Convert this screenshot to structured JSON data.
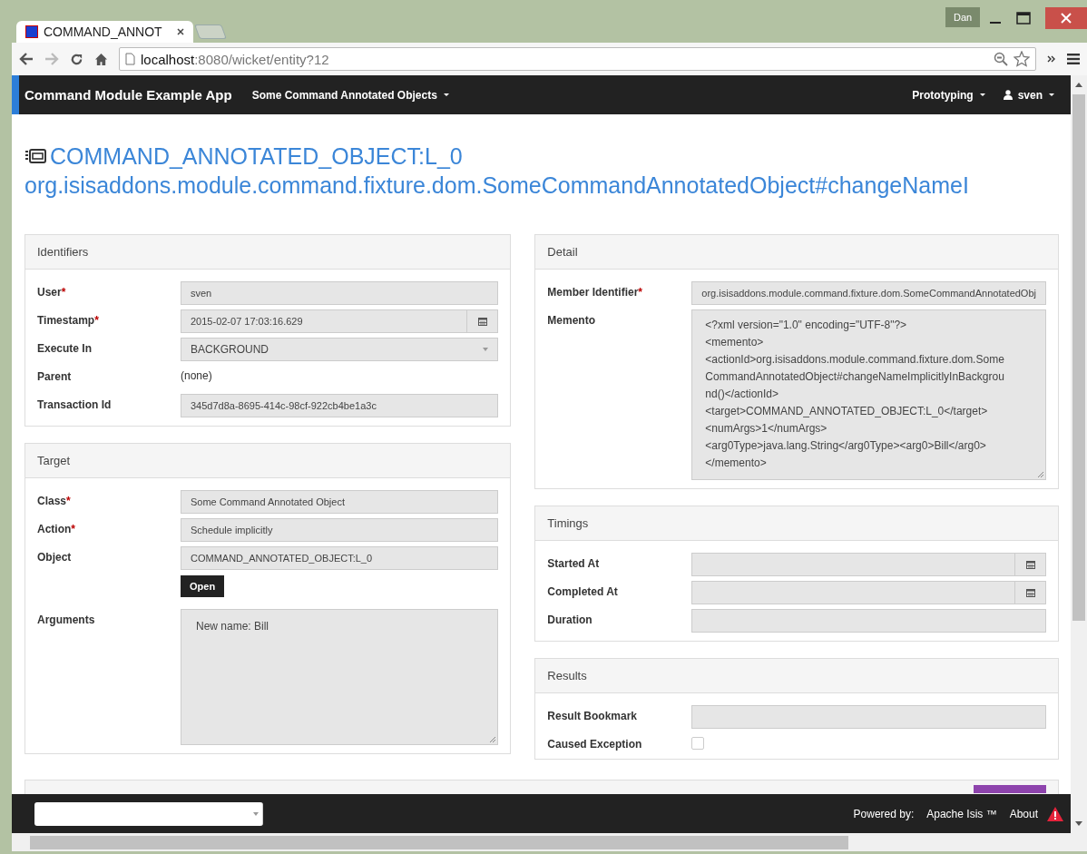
{
  "window": {
    "user_badge": "Dan"
  },
  "tabs": [
    {
      "title": "COMMAND_ANNOT",
      "selected": true
    }
  ],
  "address_bar": {
    "host": "localhost",
    "path": ":8080/wicket/entity?12"
  },
  "navbar": {
    "brand": "Command Module Example App",
    "menus": [
      "Some Command Annotated Objects",
      "Prototyping",
      "sven"
    ]
  },
  "title": {
    "line1": "COMMAND_ANNOTATED_OBJECT:L_0",
    "line2": "org.isisaddons.module.command.fixture.dom.SomeCommandAnnotatedObject#changeNameI"
  },
  "columns": [
    [
      {
        "title": "Identifiers",
        "fields": [
          {
            "label": "User",
            "marker": "*",
            "kind": "text",
            "value": "sven"
          },
          {
            "label": "Timestamp",
            "marker": "*",
            "kind": "date",
            "value": "2015-02-07 17:03:16.629"
          },
          {
            "label": "Execute In",
            "kind": "select",
            "value": "BACKGROUND"
          },
          {
            "label": "Parent",
            "kind": "plain",
            "value": "(none)"
          },
          {
            "label": "Transaction Id",
            "kind": "text",
            "value": "345d7d8a-8695-414c-98cf-922cb4be1a3c"
          }
        ]
      },
      {
        "title": "Target",
        "fields": [
          {
            "label": "Class",
            "marker": "*",
            "kind": "text",
            "value": "Some Command Annotated Object"
          },
          {
            "label": "Action",
            "marker": "*",
            "kind": "text",
            "value": "Schedule implicitly"
          },
          {
            "label": "Object",
            "kind": "text",
            "value": "COMMAND_ANNOTATED_OBJECT:L_0",
            "button": "Open"
          },
          {
            "label": "Arguments",
            "kind": "textarea",
            "lines": [
              "New name: Bill"
            ]
          }
        ]
      }
    ],
    [
      {
        "title": "Detail",
        "fields": [
          {
            "label": "Member Identifier",
            "marker": "*",
            "kind": "text",
            "value": "org.isisaddons.module.command.fixture.dom.SomeCommandAnnotatedObj"
          },
          {
            "label": "Memento",
            "kind": "memo",
            "lines": [
              "<?xml version=\"1.0\" encoding=\"UTF-8\"?>",
              "<memento>",
              "<actionId>org.isisaddons.module.command.fixture.dom.Some",
              "CommandAnnotatedObject#changeNameImplicitlyInBackgrou",
              "nd()</actionId>",
              "<target>COMMAND_ANNOTATED_OBJECT:L_0</target>",
              "<numArgs>1</numArgs>",
              "<arg0Type>java.lang.String</arg0Type><arg0>Bill</arg0>",
              "</memento>"
            ]
          }
        ]
      },
      {
        "title": "Timings",
        "fields": [
          {
            "label": "Started At",
            "kind": "date"
          },
          {
            "label": "Completed At",
            "kind": "date"
          },
          {
            "label": "Duration",
            "kind": "text"
          }
        ]
      },
      {
        "title": "Results",
        "fields": [
          {
            "label": "Result Bookmark",
            "kind": "text"
          },
          {
            "label": "Caused Exception",
            "kind": "checkbox",
            "checked": false
          }
        ]
      }
    ]
  ],
  "footer": {
    "powered_by": "Powered by:",
    "link": "Apache Isis ™",
    "about": "About"
  }
}
